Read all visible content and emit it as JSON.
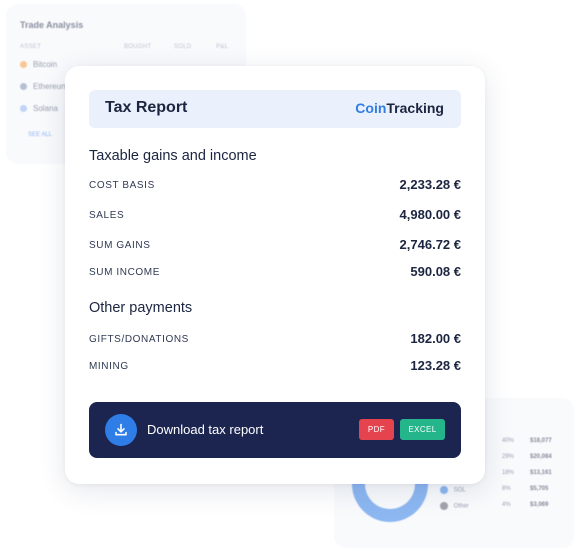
{
  "background_left": {
    "title": "Trade Analysis",
    "headers": [
      "ASSET",
      "BOUGHT",
      "SOLD",
      "P&L"
    ],
    "rows": [
      {
        "name": "Bitcoin",
        "color": "#f39a3b"
      },
      {
        "name": "Ethereum",
        "color": "#7d8bb0"
      },
      {
        "name": "Solana",
        "color": "#8fb0f0"
      }
    ],
    "link": "SEE ALL"
  },
  "background_right": {
    "legend": [
      {
        "name": "",
        "pct": "40%",
        "amount": "$18,077"
      },
      {
        "name": "",
        "pct": "29%",
        "amount": "$20,084"
      },
      {
        "name": "",
        "pct": "18%",
        "amount": "$13,161"
      },
      {
        "name": "SOL",
        "pct": "8%",
        "amount": "$5,705"
      },
      {
        "name": "Other",
        "pct": "4%",
        "amount": "$3,069"
      }
    ]
  },
  "report": {
    "title": "Tax Report",
    "logo_coin": "Coin",
    "logo_tracking": "Tracking",
    "section1_title": "Taxable gains and income",
    "section1_rows": [
      {
        "label": "COST BASIS",
        "value": "2,233.28 €"
      },
      {
        "label": "SALES",
        "value": "4,980.00 €"
      },
      {
        "label": "SUM GAINS",
        "value": "2,746.72 €"
      },
      {
        "label": "SUM INCOME",
        "value": "590.08 €"
      }
    ],
    "section2_title": "Other payments",
    "section2_rows": [
      {
        "label": "GIFTS/DONATIONS",
        "value": "182.00 €"
      },
      {
        "label": "MINING",
        "value": "123.28 €"
      }
    ],
    "download_label": "Download tax report",
    "pdf_label": "PDF",
    "excel_label": "EXCEL"
  },
  "colors": {
    "accent_blue": "#2f7de6",
    "navy": "#1b2550",
    "pdf_red": "#e5434e",
    "excel_green": "#25b58a"
  }
}
